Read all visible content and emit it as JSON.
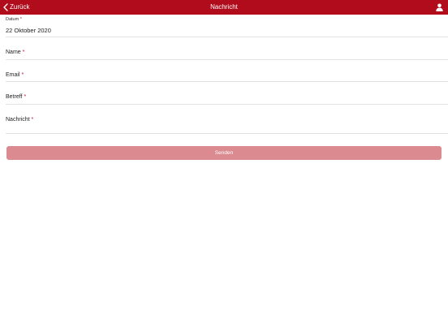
{
  "header": {
    "back_label": "Zurück",
    "title": "Nachricht",
    "back_icon": "chevron-left-icon",
    "user_icon": "person-icon"
  },
  "form": {
    "date": {
      "label": "Datum",
      "required_mark": "*",
      "value": "22 Oktober 2020"
    },
    "name": {
      "label": "Name",
      "required_mark": "*",
      "value": ""
    },
    "email": {
      "label": "Email",
      "required_mark": "*",
      "value": ""
    },
    "subject": {
      "label": "Betreff",
      "required_mark": "*",
      "value": ""
    },
    "message": {
      "label": "Nachricht",
      "required_mark": "*",
      "value": ""
    },
    "submit_label": "Senden"
  },
  "colors": {
    "header_bg": "#b00c1b",
    "button_bg": "#db8a8f",
    "required": "#c8102e"
  }
}
